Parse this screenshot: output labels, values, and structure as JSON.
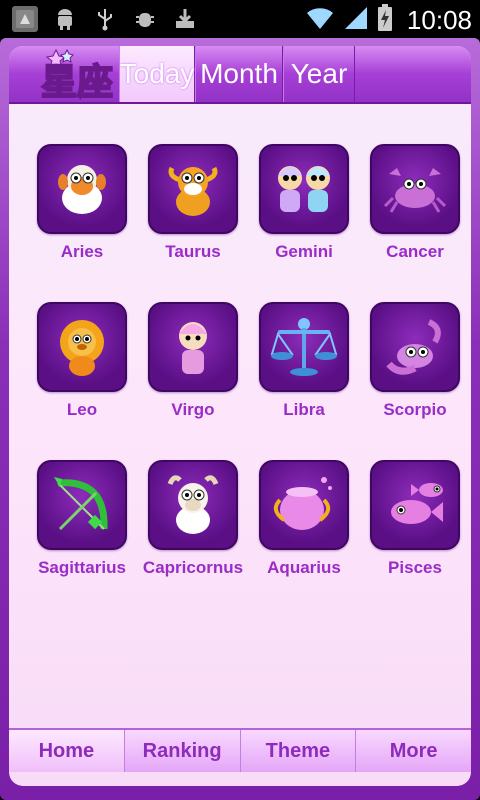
{
  "status_bar": {
    "time": "10:08",
    "left_icons": [
      "notification-app-icon",
      "android-icon",
      "usb-icon",
      "debug-icon",
      "download-icon"
    ],
    "right_icons": [
      "wifi-icon",
      "signal-icon",
      "battery-charging-icon"
    ]
  },
  "header": {
    "logo_text": "星座",
    "tabs": [
      {
        "label": "Today"
      },
      {
        "label": "Month"
      },
      {
        "label": "Year"
      }
    ]
  },
  "signs": [
    {
      "label": "Aries",
      "icon": "aries-sheep-icon"
    },
    {
      "label": "Taurus",
      "icon": "taurus-bull-icon"
    },
    {
      "label": "Gemini",
      "icon": "gemini-twins-icon"
    },
    {
      "label": "Cancer",
      "icon": "cancer-crab-icon"
    },
    {
      "label": "Leo",
      "icon": "leo-lion-icon"
    },
    {
      "label": "Virgo",
      "icon": "virgo-maiden-icon"
    },
    {
      "label": "Libra",
      "icon": "libra-scales-icon"
    },
    {
      "label": "Scorpio",
      "icon": "scorpio-scorpion-icon"
    },
    {
      "label": "Sagittarius",
      "icon": "sagittarius-bow-icon"
    },
    {
      "label": "Capricornus",
      "icon": "capricornus-goat-icon"
    },
    {
      "label": "Aquarius",
      "icon": "aquarius-vase-icon"
    },
    {
      "label": "Pisces",
      "icon": "pisces-fish-icon"
    }
  ],
  "bottom_nav": [
    {
      "label": "Home"
    },
    {
      "label": "Ranking"
    },
    {
      "label": "Theme"
    },
    {
      "label": "More"
    }
  ],
  "colors": {
    "accent": "#9a2cc7",
    "tile": "#6a1796",
    "frame": "#8a2fb8"
  }
}
